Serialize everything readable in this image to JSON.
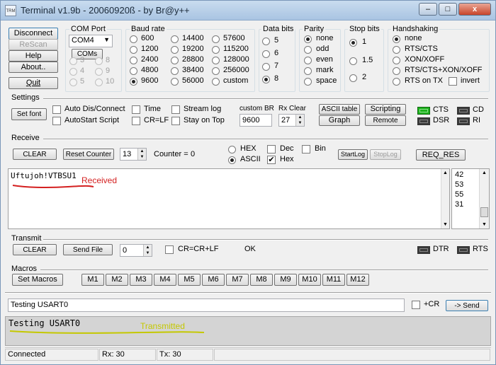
{
  "window": {
    "title": "Terminal v1.9b - 20060920ß - by Br@y++",
    "icon_text": "TRM",
    "controls": {
      "minimize": "–",
      "maximize": "□",
      "close": "x"
    }
  },
  "left_buttons": {
    "disconnect": "Disconnect",
    "rescan": "ReScan",
    "help": "Help",
    "about": "About..",
    "quit": "Quit"
  },
  "com_port": {
    "title": "COM Port",
    "selected": "COM4",
    "coms_button": "COMs",
    "numbers": [
      "3",
      "8",
      "4",
      "9",
      "5",
      "10"
    ]
  },
  "baud_rate": {
    "title": "Baud rate",
    "options": [
      "600",
      "1200",
      "2400",
      "4800",
      "9600",
      "14400",
      "19200",
      "28800",
      "38400",
      "56000",
      "57600",
      "115200",
      "128000",
      "256000",
      "custom"
    ],
    "selected": "9600"
  },
  "data_bits": {
    "title": "Data bits",
    "options": [
      "5",
      "6",
      "7",
      "8"
    ],
    "selected": "8"
  },
  "parity": {
    "title": "Parity",
    "options": [
      "none",
      "odd",
      "even",
      "mark",
      "space"
    ],
    "selected": "none"
  },
  "stop_bits": {
    "title": "Stop bits",
    "options": [
      "1",
      "1.5",
      "2"
    ],
    "selected": "1"
  },
  "handshaking": {
    "title": "Handshaking",
    "options": [
      "none",
      "RTS/CTS",
      "XON/XOFF",
      "RTS/CTS+XON/XOFF",
      "RTS on TX"
    ],
    "invert": "invert",
    "selected": "none"
  },
  "settings": {
    "title": "Settings",
    "set_font": "Set font",
    "auto_dis_connect": "Auto Dis/Connect",
    "autostart_script": "AutoStart Script",
    "time": "Time",
    "cr_lf": "CR=LF",
    "stream_log": "Stream log",
    "stay_on_top": "Stay on Top",
    "custom_br_label": "custom BR",
    "custom_br_value": "9600",
    "rx_clear_label": "Rx Clear",
    "rx_clear_value": "27",
    "ascii_table": "ASCII table",
    "graph": "Graph",
    "scripting": "Scripting",
    "remote": "Remote",
    "leds": [
      "CTS",
      "CD",
      "DSR",
      "RI"
    ]
  },
  "receive": {
    "title": "Receive",
    "clear": "CLEAR",
    "reset_counter": "Reset Counter",
    "counter_spin": "13",
    "counter_label": "Counter =",
    "counter_value": "0",
    "hex": "HEX",
    "ascii": "ASCII",
    "dec": "Dec",
    "hex_check": "Hex",
    "bin": "Bin",
    "startlog": "StartLog",
    "stoplog": "StopLog",
    "req_res": "REQ_RES",
    "text": "Uftujoh!VTBSU1",
    "annotation": "Received",
    "side_values": [
      "42",
      "53",
      "55",
      "31"
    ]
  },
  "transmit": {
    "title": "Transmit",
    "clear": "CLEAR",
    "send_file": "Send File",
    "spin_value": "0",
    "cr_crlf": "CR=CR+LF",
    "status": "OK",
    "leds": [
      "DTR",
      "RTS"
    ]
  },
  "macros": {
    "title": "Macros",
    "set_macros": "Set Macros",
    "buttons": [
      "M1",
      "M2",
      "M3",
      "M4",
      "M5",
      "M6",
      "M7",
      "M8",
      "M9",
      "M10",
      "M11",
      "M12"
    ]
  },
  "send_bar": {
    "input_value": "Testing USART0",
    "plus_cr": "+CR",
    "send": "-> Send"
  },
  "transmit_log": {
    "text": "Testing USART0",
    "annotation": "Transmitted"
  },
  "status_bar": {
    "state": "Connected",
    "rx": "Rx: 30",
    "tx": "Tx: 30"
  },
  "colors": {
    "received_annotation": "#d42020",
    "transmitted_annotation": "#c4c800",
    "led_on": "#1db21d"
  }
}
